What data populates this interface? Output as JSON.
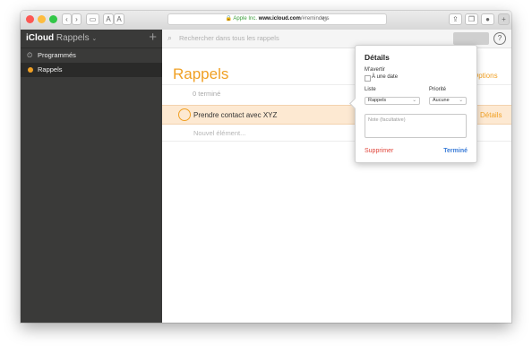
{
  "browser": {
    "colors": {
      "close": "#fc5753",
      "minimize": "#fdbc40",
      "zoom": "#33c748"
    },
    "back_icon": "chevron-left-icon",
    "forward_icon": "chevron-right-icon",
    "sidebar_toggle_icon": "sidebar-icon",
    "text_small": "A",
    "text_large": "A",
    "address": {
      "lock": "🔒",
      "org": "Apple Inc.",
      "domain": "www.icloud.com",
      "path": "/#reminders"
    },
    "reload_icon": "reload-icon"
  },
  "sidebar": {
    "brand": "iCloud",
    "app": "Rappels",
    "app_chevron": "⌄",
    "add_label": "+",
    "items": [
      {
        "icon": "clock-calendar-icon",
        "label": "Programmés"
      },
      {
        "icon": "list-dot-icon",
        "label": "Rappels",
        "color": "#f0a024"
      }
    ]
  },
  "main": {
    "search_placeholder": "Rechercher dans tous les rappels",
    "help_label": "?",
    "list_title": "Rappels",
    "options_label": "Options",
    "done_count": "0 terminé",
    "reminder_text": "Prendre contact avec XYZ",
    "details_label": "Détails",
    "new_item_placeholder": "Nouvel élément..."
  },
  "popover": {
    "title": "Détails",
    "remind_label": "M'avertir",
    "on_date_label": "À une date",
    "list_label": "Liste",
    "list_value": "Rappels",
    "priority_label": "Priorité",
    "priority_value": "Aucune",
    "note_placeholder": "Note (facultative)",
    "delete_label": "Supprimer",
    "done_label": "Terminé"
  },
  "accent": "#f0a024"
}
